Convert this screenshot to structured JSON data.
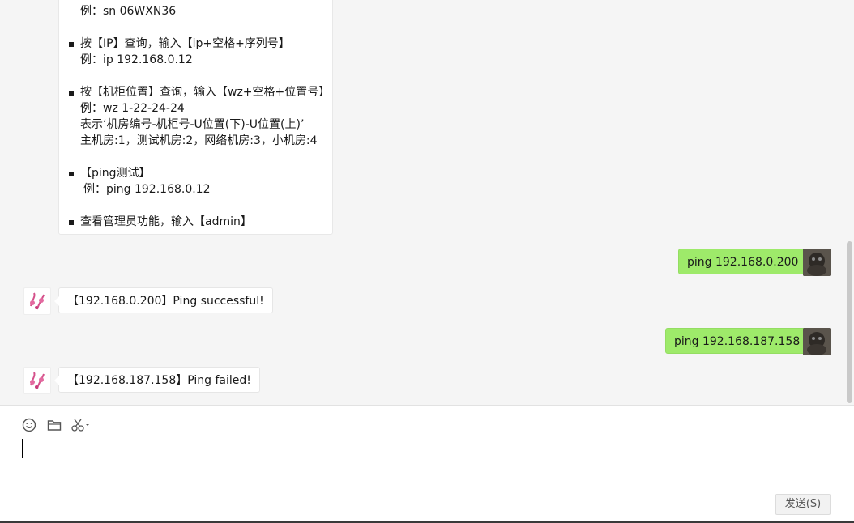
{
  "help": {
    "line_sn_example": "例：sn 06WXN36",
    "ip_title": "按【IP】查询，输入【ip+空格+序列号】",
    "ip_example": "例：ip 192.168.0.12",
    "wz_title": "按【机柜位置】查询，输入【wz+空格+位置号】",
    "wz_example": "例：wz 1-22-24-24",
    "wz_desc": "表示‘机房编号-机柜号-U位置(下)-U位置(上)’",
    "wz_rooms": "主机房:1，测试机房:2，网络机房:3，小机房:4",
    "ping_title": "【ping测试】",
    "ping_example": "例：ping 192.168.0.12",
    "admin_title": "查看管理员功能，输入【admin】"
  },
  "messages": [
    {
      "side": "right",
      "text": "ping 192.168.0.200"
    },
    {
      "side": "left",
      "text": "【192.168.0.200】Ping successful!"
    },
    {
      "side": "right",
      "text": "ping 192.168.187.158"
    },
    {
      "side": "left",
      "text": "【192.168.187.158】Ping failed!"
    }
  ],
  "toolbar": {
    "icons": [
      "emoji-icon",
      "folder-icon",
      "scissors-icon"
    ]
  },
  "input": {
    "value": ""
  },
  "send_button": {
    "label": "发送(S)"
  }
}
